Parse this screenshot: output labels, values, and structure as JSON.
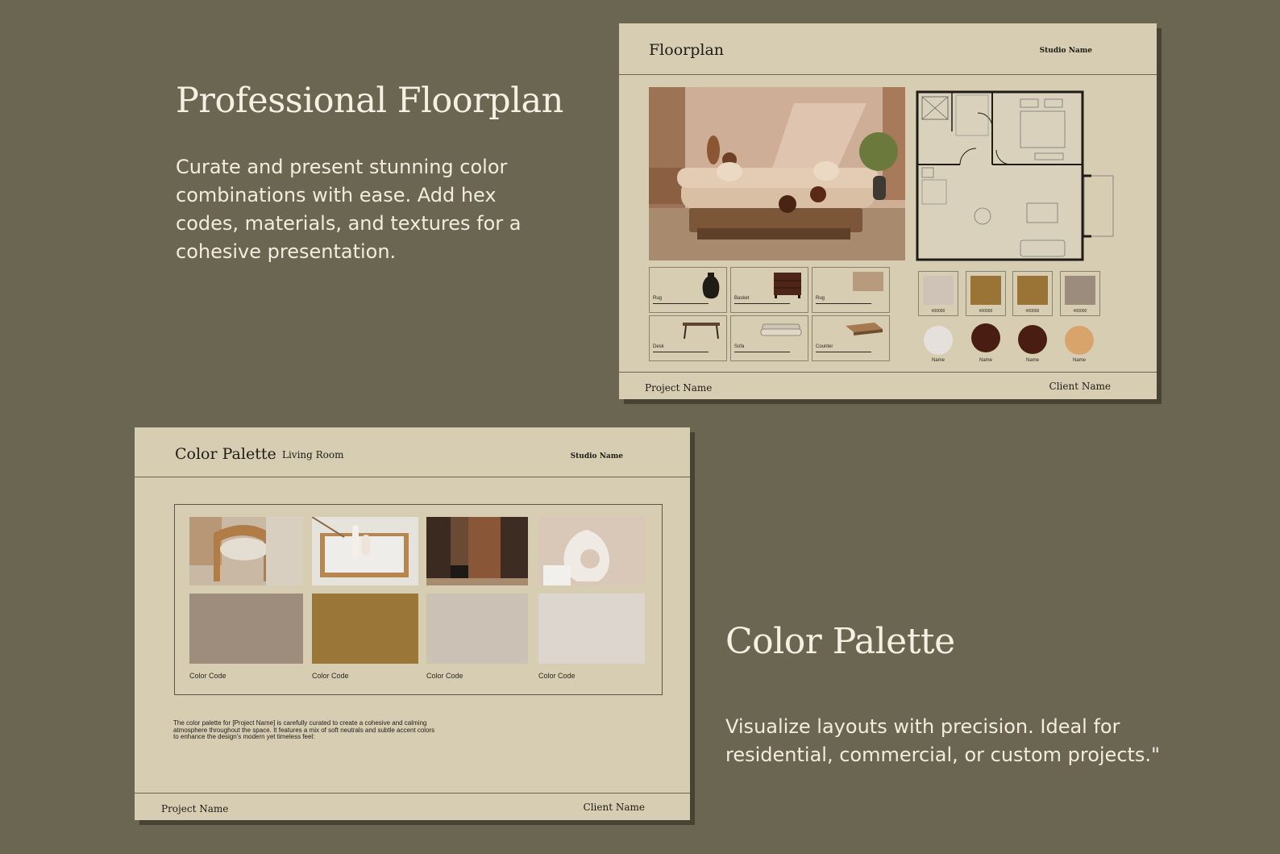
{
  "left_copy": {
    "title": "Professional Floorplan",
    "description": "Curate and present stunning color combinations with ease. Add hex codes, materials, and textures for a cohesive presentation."
  },
  "right_copy": {
    "title": "Color Palette",
    "description": "Visualize layouts with precision. Ideal for residential, commercial, or custom projects.\""
  },
  "floorplan_card": {
    "title": "Floorplan",
    "studio": "Studio Name",
    "project": "Project Name",
    "client": "Client Name",
    "items": [
      {
        "label": "Rug",
        "icon": "vase-icon"
      },
      {
        "label": "Basket",
        "icon": "dresser-icon"
      },
      {
        "label": "Rug",
        "icon": "rug-icon"
      },
      {
        "label": "Desk",
        "icon": "desk-icon"
      },
      {
        "label": "Sofa",
        "icon": "sofa-icon"
      },
      {
        "label": "Counter",
        "icon": "counter-icon"
      }
    ],
    "swatches": [
      {
        "code": "#00000",
        "color": "#cfc3b8"
      },
      {
        "code": "#00000",
        "color": "#9a7437"
      },
      {
        "code": "#00000",
        "color": "#9a7437"
      },
      {
        "code": "#00000",
        "color": "#9c8c7e"
      }
    ],
    "materials": [
      {
        "name": "Name",
        "color": "#e6e0dc"
      },
      {
        "name": "Name",
        "color": "#4a1d12"
      },
      {
        "name": "Name",
        "color": "#4a1d12"
      },
      {
        "name": "Name",
        "color": "#d9a46c"
      }
    ]
  },
  "palette_card": {
    "title": "Color Palette",
    "room": "Living Room",
    "studio": "Studio Name",
    "project": "Project Name",
    "client": "Client Name",
    "colors": [
      {
        "code": "Color Code",
        "hex": "#9e8d7c"
      },
      {
        "code": "Color Code",
        "hex": "#9a7639"
      },
      {
        "code": "Color Code",
        "hex": "#cbc1b5"
      },
      {
        "code": "Color Code",
        "hex": "#ddd6cf"
      }
    ],
    "blurb": "The color palette for [Project Name] is carefully curated to create a cohesive and calming atmosphere throughout the space. It features a mix of soft neutrals and subtle accent colors to enhance the design's modern yet timeless feel:"
  }
}
